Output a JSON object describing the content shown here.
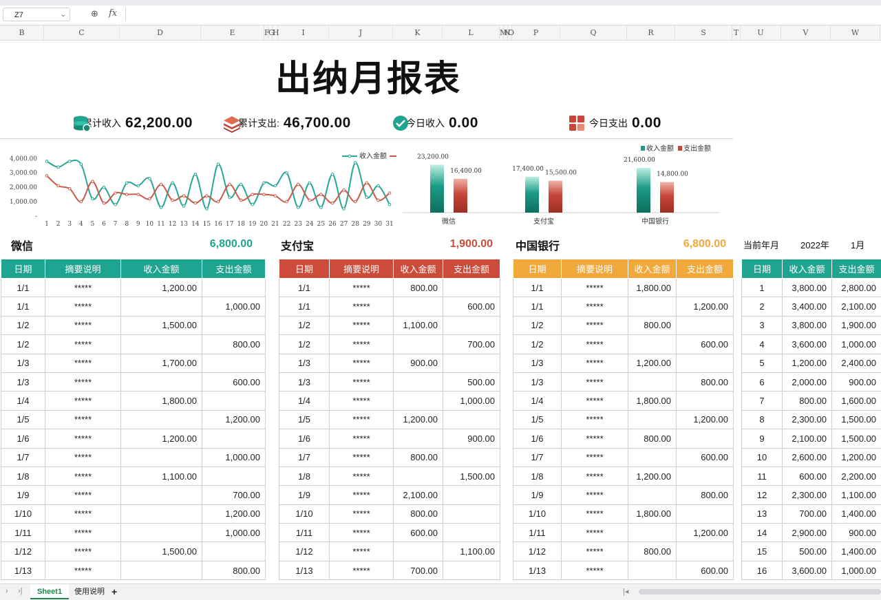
{
  "formula_bar": {
    "cell_ref": "Z7",
    "fx_label": "fx"
  },
  "columns": [
    "B",
    "C",
    "D",
    "E",
    "F",
    "G",
    "H",
    "I",
    "J",
    "K",
    "L",
    "M",
    "N",
    "O",
    "P",
    "Q",
    "R",
    "S",
    "T",
    "U",
    "V",
    "W"
  ],
  "title": "出纳月报表",
  "kpis": [
    {
      "label": "累计收入",
      "value": "62,200.00"
    },
    {
      "label": "累计支出:",
      "value": "46,700.00"
    },
    {
      "label": "今日收入",
      "value": "0.00"
    },
    {
      "label": "今日支出",
      "value": "0.00"
    }
  ],
  "colors": {
    "green": "#1fa58f",
    "red": "#cc4b3a",
    "orange": "#f2a93b"
  },
  "chart_data": [
    {
      "type": "line",
      "legend": [
        "收入金额",
        ""
      ],
      "legend_position": "top-right",
      "x": [
        1,
        2,
        3,
        4,
        5,
        6,
        7,
        8,
        9,
        10,
        11,
        12,
        13,
        14,
        15,
        16,
        17,
        18,
        19,
        20,
        21,
        22,
        23,
        24,
        25,
        26,
        27,
        28,
        29,
        30,
        31
      ],
      "yticks": [
        "4,000.00",
        "3,000.00",
        "2,000.00",
        "1,000.00",
        "-"
      ],
      "ylim": [
        0,
        4300
      ],
      "series": [
        {
          "name": "收入金额",
          "color": "#27a697",
          "values": [
            3800,
            3400,
            3800,
            3600,
            1200,
            2000,
            800,
            2300,
            2100,
            2600,
            600,
            2300,
            700,
            2900,
            500,
            3600,
            1300,
            2200,
            800,
            2300,
            2100,
            3000,
            600,
            2300,
            600,
            2900,
            500,
            3700,
            1300,
            2100,
            800
          ]
        },
        {
          "color": "#c95a48",
          "values": [
            2800,
            2100,
            1900,
            1000,
            2400,
            900,
            1600,
            1500,
            1500,
            1200,
            2200,
            1100,
            1400,
            900,
            1400,
            1000,
            2200,
            1100,
            1500,
            1500,
            1400,
            1000,
            2200,
            1100,
            1500,
            900,
            1800,
            1000,
            2300,
            1100,
            1600
          ]
        }
      ]
    },
    {
      "type": "bar",
      "legend": [
        "收入金额",
        "支出金额"
      ],
      "legend_position": "top-right",
      "categories": [
        "微信",
        "支付宝",
        "中国银行"
      ],
      "series": [
        {
          "name": "收入金额",
          "color": "#1b9b86",
          "values": [
            23200,
            17400,
            21600
          ],
          "labels": [
            "23,200.00",
            "17,400.00",
            "21,600.00"
          ]
        },
        {
          "name": "支出金额",
          "color": "#c8463a",
          "values": [
            16400,
            15500,
            14800
          ],
          "labels": [
            "16,400.00",
            "15,500.00",
            "14,800.00"
          ]
        }
      ]
    }
  ],
  "sections": {
    "wechat": {
      "name": "微信",
      "total": "6,800.00",
      "headers": [
        "日期",
        "摘要说明",
        "收入金额",
        "支出金额"
      ],
      "rows": [
        [
          "1/1",
          "*****",
          "1,200.00",
          ""
        ],
        [
          "1/1",
          "*****",
          "",
          "1,000.00"
        ],
        [
          "1/2",
          "*****",
          "1,500.00",
          ""
        ],
        [
          "1/2",
          "*****",
          "",
          "800.00"
        ],
        [
          "1/3",
          "*****",
          "1,700.00",
          ""
        ],
        [
          "1/3",
          "*****",
          "",
          "600.00"
        ],
        [
          "1/4",
          "*****",
          "1,800.00",
          ""
        ],
        [
          "1/5",
          "*****",
          "",
          "1,200.00"
        ],
        [
          "1/6",
          "*****",
          "1,200.00",
          ""
        ],
        [
          "1/7",
          "*****",
          "",
          "1,000.00"
        ],
        [
          "1/8",
          "*****",
          "1,100.00",
          ""
        ],
        [
          "1/9",
          "*****",
          "",
          "700.00"
        ],
        [
          "1/10",
          "*****",
          "",
          "1,200.00"
        ],
        [
          "1/11",
          "*****",
          "",
          "1,000.00"
        ],
        [
          "1/12",
          "*****",
          "1,500.00",
          ""
        ],
        [
          "1/13",
          "*****",
          "",
          "800.00"
        ]
      ]
    },
    "alipay": {
      "name": "支付宝",
      "total": "1,900.00",
      "headers": [
        "日期",
        "摘要说明",
        "收入金额",
        "支出金额"
      ],
      "rows": [
        [
          "1/1",
          "*****",
          "800.00",
          ""
        ],
        [
          "1/1",
          "*****",
          "",
          "600.00"
        ],
        [
          "1/2",
          "*****",
          "1,100.00",
          ""
        ],
        [
          "1/2",
          "*****",
          "",
          "700.00"
        ],
        [
          "1/3",
          "*****",
          "900.00",
          ""
        ],
        [
          "1/3",
          "*****",
          "",
          "500.00"
        ],
        [
          "1/4",
          "*****",
          "",
          "1,000.00"
        ],
        [
          "1/5",
          "*****",
          "1,200.00",
          ""
        ],
        [
          "1/6",
          "*****",
          "",
          "900.00"
        ],
        [
          "1/7",
          "*****",
          "800.00",
          ""
        ],
        [
          "1/8",
          "*****",
          "",
          "1,500.00"
        ],
        [
          "1/9",
          "*****",
          "2,100.00",
          ""
        ],
        [
          "1/10",
          "*****",
          "800.00",
          ""
        ],
        [
          "1/11",
          "*****",
          "600.00",
          ""
        ],
        [
          "1/12",
          "*****",
          "",
          "1,100.00"
        ],
        [
          "1/13",
          "*****",
          "700.00",
          ""
        ]
      ]
    },
    "boc": {
      "name": "中国银行",
      "total": "6,800.00",
      "headers": [
        "日期",
        "摘要说明",
        "收入金额",
        "支出金额"
      ],
      "rows": [
        [
          "1/1",
          "*****",
          "1,800.00",
          ""
        ],
        [
          "1/1",
          "*****",
          "",
          "1,200.00"
        ],
        [
          "1/2",
          "*****",
          "800.00",
          ""
        ],
        [
          "1/2",
          "*****",
          "",
          "600.00"
        ],
        [
          "1/3",
          "*****",
          "1,200.00",
          ""
        ],
        [
          "1/3",
          "*****",
          "",
          "800.00"
        ],
        [
          "1/4",
          "*****",
          "1,800.00",
          ""
        ],
        [
          "1/5",
          "*****",
          "",
          "1,200.00"
        ],
        [
          "1/6",
          "*****",
          "800.00",
          ""
        ],
        [
          "1/7",
          "*****",
          "",
          "600.00"
        ],
        [
          "1/8",
          "*****",
          "1,200.00",
          ""
        ],
        [
          "1/9",
          "*****",
          "",
          "800.00"
        ],
        [
          "1/10",
          "*****",
          "1,800.00",
          ""
        ],
        [
          "1/11",
          "*****",
          "",
          "1,200.00"
        ],
        [
          "1/12",
          "*****",
          "800.00",
          ""
        ],
        [
          "1/13",
          "*****",
          "",
          "600.00"
        ]
      ]
    },
    "summary": {
      "period_label": "当前年月",
      "year": "2022年",
      "month": "1月",
      "headers": [
        "日期",
        "收入金额",
        "支出金额"
      ],
      "rows": [
        [
          "1",
          "3,800.00",
          "2,800.00"
        ],
        [
          "2",
          "3,400.00",
          "2,100.00"
        ],
        [
          "3",
          "3,800.00",
          "1,900.00"
        ],
        [
          "4",
          "3,600.00",
          "1,000.00"
        ],
        [
          "5",
          "1,200.00",
          "2,400.00"
        ],
        [
          "6",
          "2,000.00",
          "900.00"
        ],
        [
          "7",
          "800.00",
          "1,600.00"
        ],
        [
          "8",
          "2,300.00",
          "1,500.00"
        ],
        [
          "9",
          "2,100.00",
          "1,500.00"
        ],
        [
          "10",
          "2,600.00",
          "1,200.00"
        ],
        [
          "11",
          "600.00",
          "2,200.00"
        ],
        [
          "12",
          "2,300.00",
          "1,100.00"
        ],
        [
          "13",
          "700.00",
          "1,400.00"
        ],
        [
          "14",
          "2,900.00",
          "900.00"
        ],
        [
          "15",
          "500.00",
          "1,400.00"
        ],
        [
          "16",
          "3,600.00",
          "1,000.00"
        ]
      ]
    }
  },
  "sheet_tabs": [
    "Sheet1",
    "使用说明"
  ],
  "add_sheet": "+"
}
